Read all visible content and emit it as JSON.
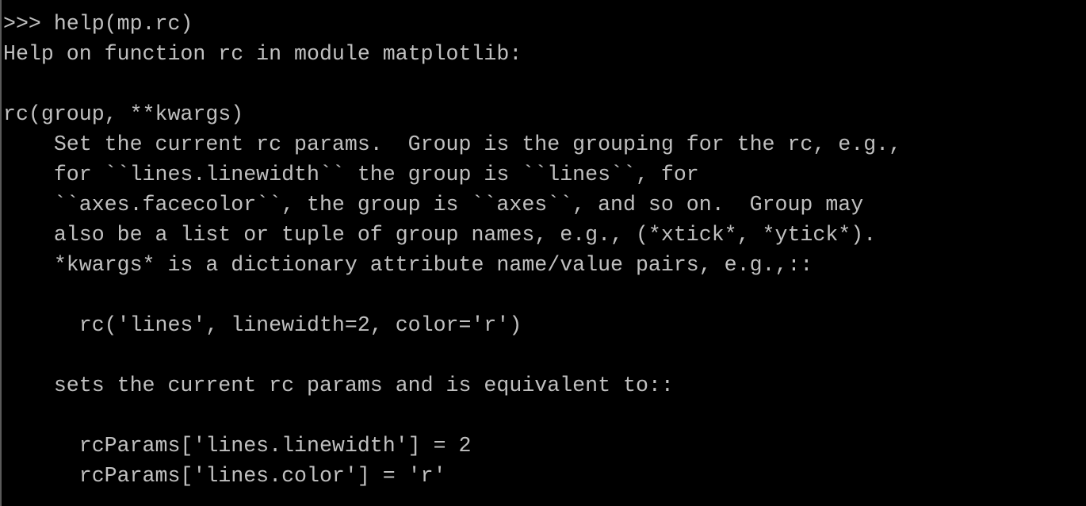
{
  "terminal": {
    "lines": [
      ">>> help(mp.rc)",
      "Help on function rc in module matplotlib:",
      "",
      "rc(group, **kwargs)",
      "    Set the current rc params.  Group is the grouping for the rc, e.g.,",
      "    for ``lines.linewidth`` the group is ``lines``, for",
      "    ``axes.facecolor``, the group is ``axes``, and so on.  Group may",
      "    also be a list or tuple of group names, e.g., (*xtick*, *ytick*).",
      "    *kwargs* is a dictionary attribute name/value pairs, e.g.,::",
      "",
      "      rc('lines', linewidth=2, color='r')",
      "",
      "    sets the current rc params and is equivalent to::",
      "",
      "      rcParams['lines.linewidth'] = 2",
      "      rcParams['lines.color'] = 'r'"
    ],
    "background_color": "#000000",
    "text_color": "#c0c0c0"
  }
}
